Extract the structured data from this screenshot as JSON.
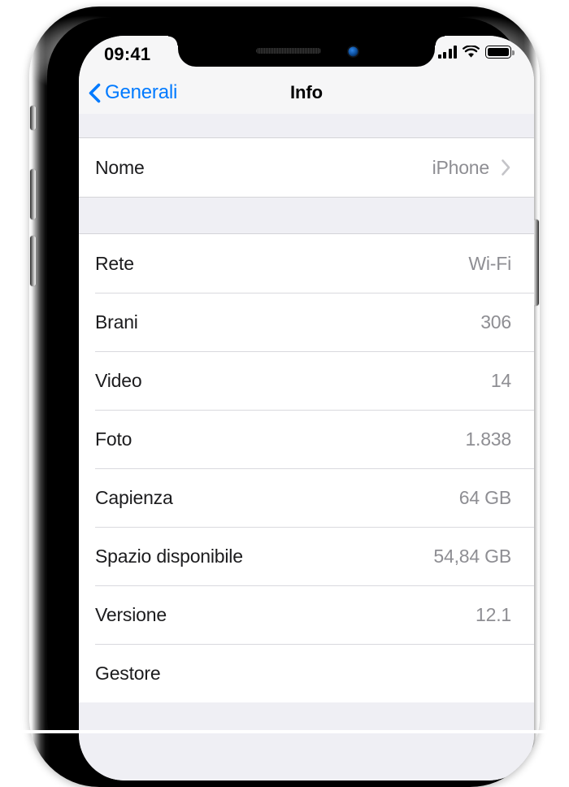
{
  "device": {
    "label": "iPhone X",
    "frame_color": "#000000",
    "band_color": "#c8c8c8"
  },
  "status_bar": {
    "time": "09:41",
    "signal_icon": "cellular-signal-icon",
    "signal_bars": 4,
    "wifi_icon": "wifi-icon",
    "battery_icon": "battery-full-icon",
    "battery_level_percent": 100
  },
  "notch": {
    "speaker_icon": "speaker-grille-icon",
    "camera_icon": "front-camera-icon"
  },
  "nav_bar": {
    "back_icon": "chevron-left-icon",
    "back_label": "Generali",
    "title": "Info",
    "accent_color": "#007AFF",
    "background_color": "#F6F6F7"
  },
  "table": {
    "background_color": "#EFEFF4",
    "row_background_color": "#FFFFFF",
    "separator_color": "#D9D9DE",
    "label_color": "#1C1C1E",
    "value_color": "#8E8E93",
    "sections": [
      {
        "name": "name-section",
        "rows": [
          {
            "name": "row-nome",
            "label": "Nome",
            "value": "iPhone",
            "has_chevron": true,
            "interactable": true
          }
        ]
      },
      {
        "name": "device-info-section",
        "rows": [
          {
            "name": "row-rete",
            "label": "Rete",
            "value": "Wi-Fi",
            "has_chevron": false,
            "interactable": false
          },
          {
            "name": "row-brani",
            "label": "Brani",
            "value": "306",
            "has_chevron": false,
            "interactable": false
          },
          {
            "name": "row-video",
            "label": "Video",
            "value": "14",
            "has_chevron": false,
            "interactable": false
          },
          {
            "name": "row-foto",
            "label": "Foto",
            "value": "1.838",
            "has_chevron": false,
            "interactable": false
          },
          {
            "name": "row-capienza",
            "label": "Capienza",
            "value": "64 GB",
            "has_chevron": false,
            "interactable": false
          },
          {
            "name": "row-spazio-disponibile",
            "label": "Spazio disponibile",
            "value": "54,84 GB",
            "has_chevron": false,
            "interactable": false
          },
          {
            "name": "row-versione",
            "label": "Versione",
            "value": "12.1",
            "has_chevron": false,
            "interactable": false
          },
          {
            "name": "row-gestore",
            "label": "Gestore",
            "value": "",
            "has_chevron": false,
            "interactable": false
          }
        ]
      }
    ]
  },
  "hardware_buttons": [
    {
      "name": "mute-switch",
      "side": "left"
    },
    {
      "name": "volume-up-button",
      "side": "left"
    },
    {
      "name": "volume-down-button",
      "side": "left"
    },
    {
      "name": "side-power-button",
      "side": "right"
    }
  ]
}
